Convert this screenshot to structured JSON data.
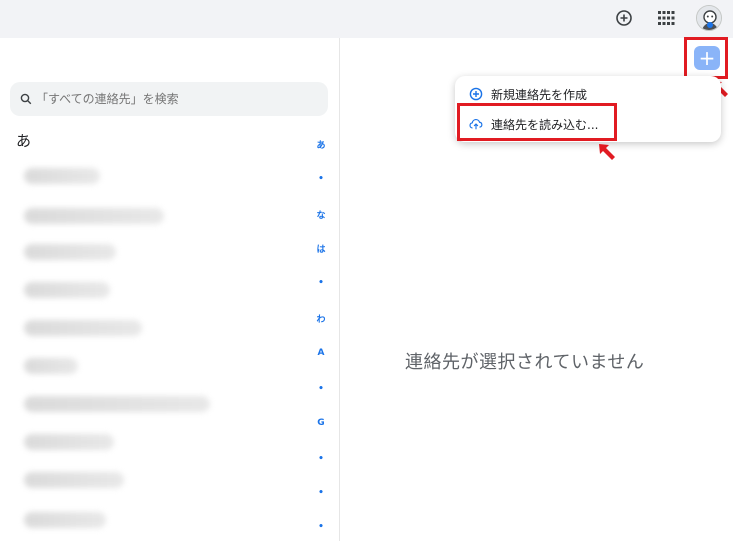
{
  "search": {
    "placeholder": "「すべての連絡先」を検索"
  },
  "contacts": {
    "section_letter": "あ"
  },
  "index_letters": [
    "あ",
    "•",
    "な",
    "は",
    "•",
    "わ",
    "A",
    "•",
    "G",
    "•",
    "•",
    "•"
  ],
  "create_menu": {
    "new_contact": "新規連絡先を作成",
    "import_contacts": "連絡先を読み込む..."
  },
  "detail": {
    "empty_message": "連絡先が選択されていません"
  },
  "icons": {
    "add_circle": "add-circle-icon",
    "apps": "apps-grid-icon",
    "avatar": "avatar-icon",
    "search": "search-icon",
    "plus": "plus-icon",
    "upload": "cloud-upload-icon"
  },
  "colors": {
    "accent": "#1a73e8",
    "highlight": "#e11b22",
    "plus_button": "#8ab4f8"
  }
}
